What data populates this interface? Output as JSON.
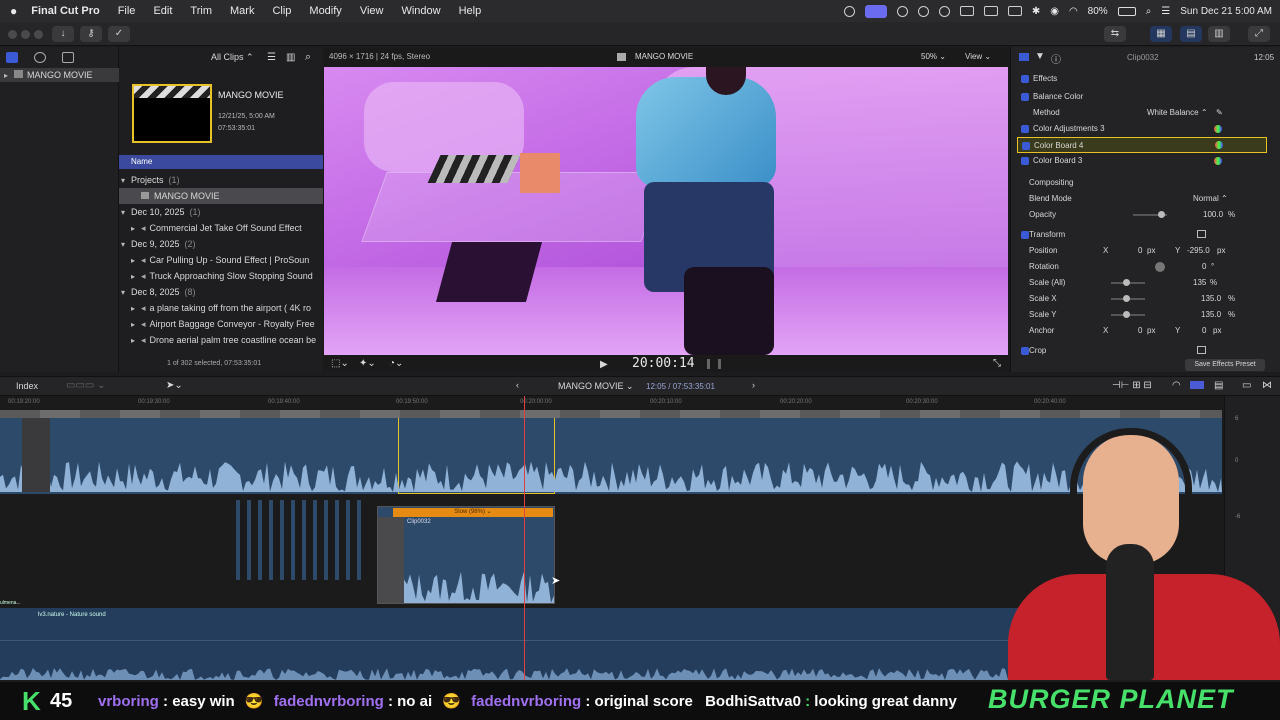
{
  "menubar": {
    "app_name": "Final Cut Pro",
    "items": [
      "File",
      "Edit",
      "Trim",
      "Mark",
      "Clip",
      "Modify",
      "View",
      "Window",
      "Help"
    ],
    "battery": "80%",
    "datetime": "Sun Dec 21  5:00 AM"
  },
  "sidebar": {
    "library": "MANGO MOVIE"
  },
  "browser": {
    "filter": "All Clips",
    "thumbnail_title": "MANGO MOVIE",
    "thumbnail_date": "12/21/25, 5:00 AM",
    "thumbnail_duration": "07:53:35:01",
    "column_header": "Name",
    "rows": [
      {
        "label": "Projects",
        "count": "(1)",
        "kind": "group"
      },
      {
        "label": "MANGO MOVIE",
        "count": "",
        "kind": "selected"
      },
      {
        "label": "Dec 10, 2025",
        "count": "(1)",
        "kind": "group"
      },
      {
        "label": "Commercial Jet Take Off Sound Effect",
        "count": "",
        "kind": "item"
      },
      {
        "label": "Dec 9, 2025",
        "count": "(2)",
        "kind": "group"
      },
      {
        "label": "Car Pulling Up - Sound Effect  |  ProSoun",
        "count": "",
        "kind": "item"
      },
      {
        "label": "Truck Approaching Slow Stopping Sound",
        "count": "",
        "kind": "item"
      },
      {
        "label": "Dec 8, 2025",
        "count": "(8)",
        "kind": "group"
      },
      {
        "label": "a plane taking off from the airport ( 4K ro",
        "count": "",
        "kind": "item"
      },
      {
        "label": "Airport Baggage Conveyor - Royalty Free",
        "count": "",
        "kind": "item"
      },
      {
        "label": "Drone aerial palm tree coastline ocean be",
        "count": "",
        "kind": "item"
      }
    ],
    "status": "1 of 302 selected, 07:53:35:01"
  },
  "viewer": {
    "format": "4096 × 1716 | 24 fps, Stereo",
    "title": "MANGO MOVIE",
    "zoom": "50%",
    "view_menu": "View",
    "timecode": "20:00:14"
  },
  "inspector": {
    "clip_name": "Clip0032",
    "clip_duration": "12:05",
    "effects_label": "Effects",
    "balance_color": "Balance Color",
    "method_label": "Method",
    "method_value": "White Balance",
    "color_adjustments": "Color Adjustments 3",
    "color_board_4": "Color Board 4",
    "color_board_3": "Color Board 3",
    "compositing": "Compositing",
    "blend_mode_label": "Blend Mode",
    "blend_mode_value": "Normal",
    "opacity_label": "Opacity",
    "opacity_value": "100.0",
    "opacity_unit": "%",
    "transform": "Transform",
    "position_label": "Position",
    "position_x_label": "X",
    "position_x": "0",
    "position_y_label": "Y",
    "position_y": "-295.0",
    "px_unit": "px",
    "rotation_label": "Rotation",
    "rotation_value": "0",
    "degree_unit": "°",
    "scale_all_label": "Scale (All)",
    "scale_all_value": "135",
    "scale_x_label": "Scale X",
    "scale_x_value": "135.0",
    "scale_y_label": "Scale Y",
    "scale_y_value": "135.0",
    "anchor_label": "Anchor",
    "anchor_x": "0",
    "anchor_y": "0",
    "crop": "Crop",
    "save_preset": "Save Effects Preset"
  },
  "timeline": {
    "index_label": "Index",
    "project_name": "MANGO MOVIE",
    "position": "12:05 / 07:53:35:01",
    "ruler": [
      "00:19:20:00",
      "00:19:30:00",
      "00:19:40:00",
      "00:19:50:00",
      "00:20:00:00",
      "00:20:10:00",
      "00:20:20:00",
      "00:20:30:00",
      "00:20:40:00"
    ],
    "clip_label": "Clip0032",
    "retime_label": "Slow (98%)",
    "audio_label": "lv3.nature - Nature sound",
    "left_label": "ulmena..."
  },
  "chat": {
    "logo": "K",
    "count": "45",
    "messages": [
      {
        "user": "vrboring",
        "text": "easy win"
      },
      {
        "user": "fadednvrboring",
        "text": "no ai"
      },
      {
        "user": "fadednvrboring",
        "text": "original score"
      },
      {
        "user": "BodhiSattva0",
        "text": "looking great danny"
      }
    ],
    "brand": "BURGER PLANET"
  },
  "colors": {
    "accent": "#3b5bd6",
    "selection": "#e8c326",
    "retime": "#e58a12",
    "playhead": "#e04040",
    "chat_green": "#47e06a"
  }
}
